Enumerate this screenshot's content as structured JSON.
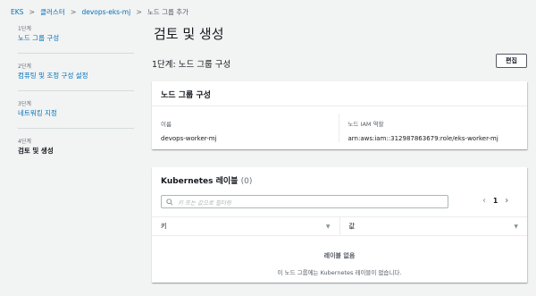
{
  "breadcrumb": {
    "items": [
      "EKS",
      "클러스터",
      "devops-eks-mj"
    ],
    "current": "노드 그룹 추가"
  },
  "steps": [
    {
      "num": "1단계",
      "name": "노드 그룹 구성"
    },
    {
      "num": "2단계",
      "name": "컴퓨팅 및 조정 구성 설정"
    },
    {
      "num": "3단계",
      "name": "네트워킹 지정"
    },
    {
      "num": "4단계",
      "name": "검토 및 생성"
    }
  ],
  "page": {
    "title": "검토 및 생성",
    "section_title": "1단계: 노드 그룹 구성",
    "edit_label": "편집"
  },
  "node_group_card": {
    "title": "노드 그룹 구성",
    "name_label": "이름",
    "name_value": "devops-worker-mj",
    "role_label": "노드 IAM 역할",
    "role_value": "arn:aws:iam::312987863679:role/eks-worker-mj"
  },
  "labels_card": {
    "title": "Kubernetes 레이블",
    "count": "(0)",
    "filter_placeholder": "키 또는 값으로 필터링",
    "page_number": "1",
    "prev_icon": "chevron-left-icon",
    "next_icon": "chevron-right-icon",
    "col_key": "키",
    "col_value": "값",
    "empty_title": "레이블 없음",
    "empty_desc": "이 노드 그룹에는 Kubernetes 레이블이 없습니다."
  },
  "colors": {
    "link": "#0073bb",
    "background": "#f2f3f3",
    "text": "#16191f"
  }
}
